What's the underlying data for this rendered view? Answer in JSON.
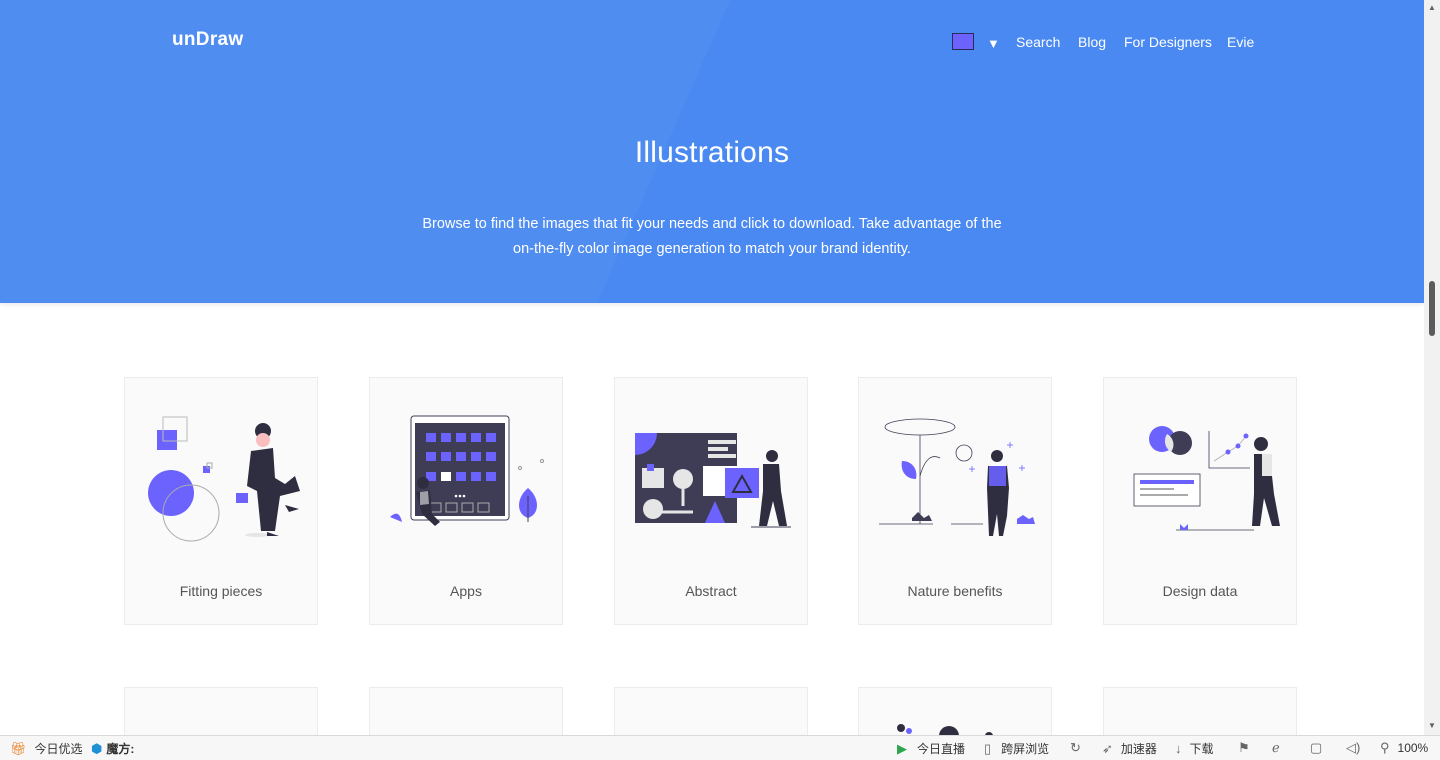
{
  "header": {
    "logo": "unDraw",
    "color_swatch": "#6c63ff",
    "caret": "▼",
    "nav": [
      "Search",
      "Blog",
      "For Designers",
      "Evie"
    ]
  },
  "hero": {
    "title": "Illustrations",
    "description": "Browse to find the images that fit your needs and click to download. Take advantage of the on-the-fly color image generation to match your brand identity."
  },
  "colors": {
    "hero_bg": "#4a89f1",
    "accent": "#6c63ff",
    "dark": "#2f2e41"
  },
  "cards": [
    {
      "label": "Fitting pieces"
    },
    {
      "label": "Apps"
    },
    {
      "label": "Abstract"
    },
    {
      "label": "Nature benefits"
    },
    {
      "label": "Design data"
    }
  ],
  "statusbar": {
    "today_pick": "今日优选",
    "magic_cube": "魔方:",
    "live": "今日直播",
    "cross_screen": "跨屏浏览",
    "accelerator": "加速器",
    "download": "下载",
    "zoom": "100%"
  }
}
